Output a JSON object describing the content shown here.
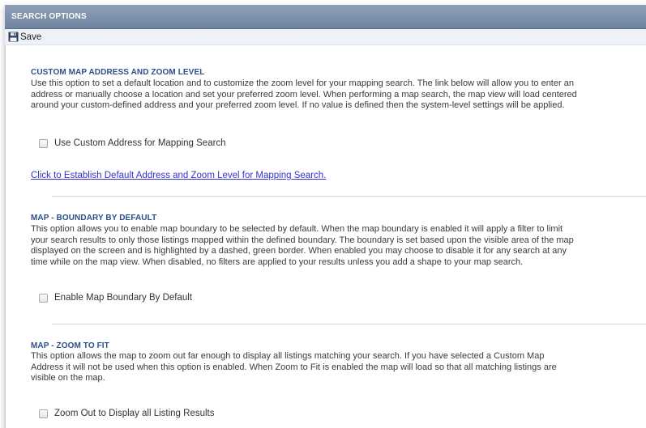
{
  "header": {
    "title": "SEARCH OPTIONS"
  },
  "toolbar": {
    "save_label": "Save",
    "save_icon": "floppy-disk-icon"
  },
  "sections": [
    {
      "title": "CUSTOM MAP ADDRESS AND ZOOM LEVEL",
      "lines": [
        "Use this option to set a default location and to customize the zoom level for your mapping search. The link below will allow you to enter an",
        "address or manually choose a location and set your preferred zoom level. When performing a map search, the map view will load centered",
        "around your custom-defined address and your preferred zoom level. If no value is defined then the system-level settings will be applied."
      ],
      "checkbox_label": "Use Custom Address for Mapping Search",
      "checked": false,
      "link_text": "Click to Establish Default Address and Zoom Level for Mapping Search."
    },
    {
      "title": "MAP - BOUNDARY BY DEFAULT",
      "lines": [
        "This option allows you to enable map boundary to be selected by default. When the map boundary is enabled it will apply a filter to limit",
        "your search results to only those listings mapped within the defined boundary. The boundary is set based upon the visible area of the map",
        "displayed on the screen and is highlighted by a dashed, green border. When enabled you may choose to disable it for any search at any",
        "time while on the map view. When disabled, no filters are applied to your results unless you add a shape to your map search."
      ],
      "checkbox_label": "Enable Map Boundary By Default",
      "checked": false
    },
    {
      "title": "MAP - ZOOM TO FIT",
      "lines": [
        "This option allows the map to zoom out far enough to display all listings matching your search. If you have selected a Custom Map",
        "Address it will not be used when this option is enabled. When Zoom to Fit is enabled the map will load so that all matching listings are",
        "visible on the map."
      ],
      "checkbox_label": "Zoom Out to Display all Listing Results",
      "checked": false
    }
  ]
}
